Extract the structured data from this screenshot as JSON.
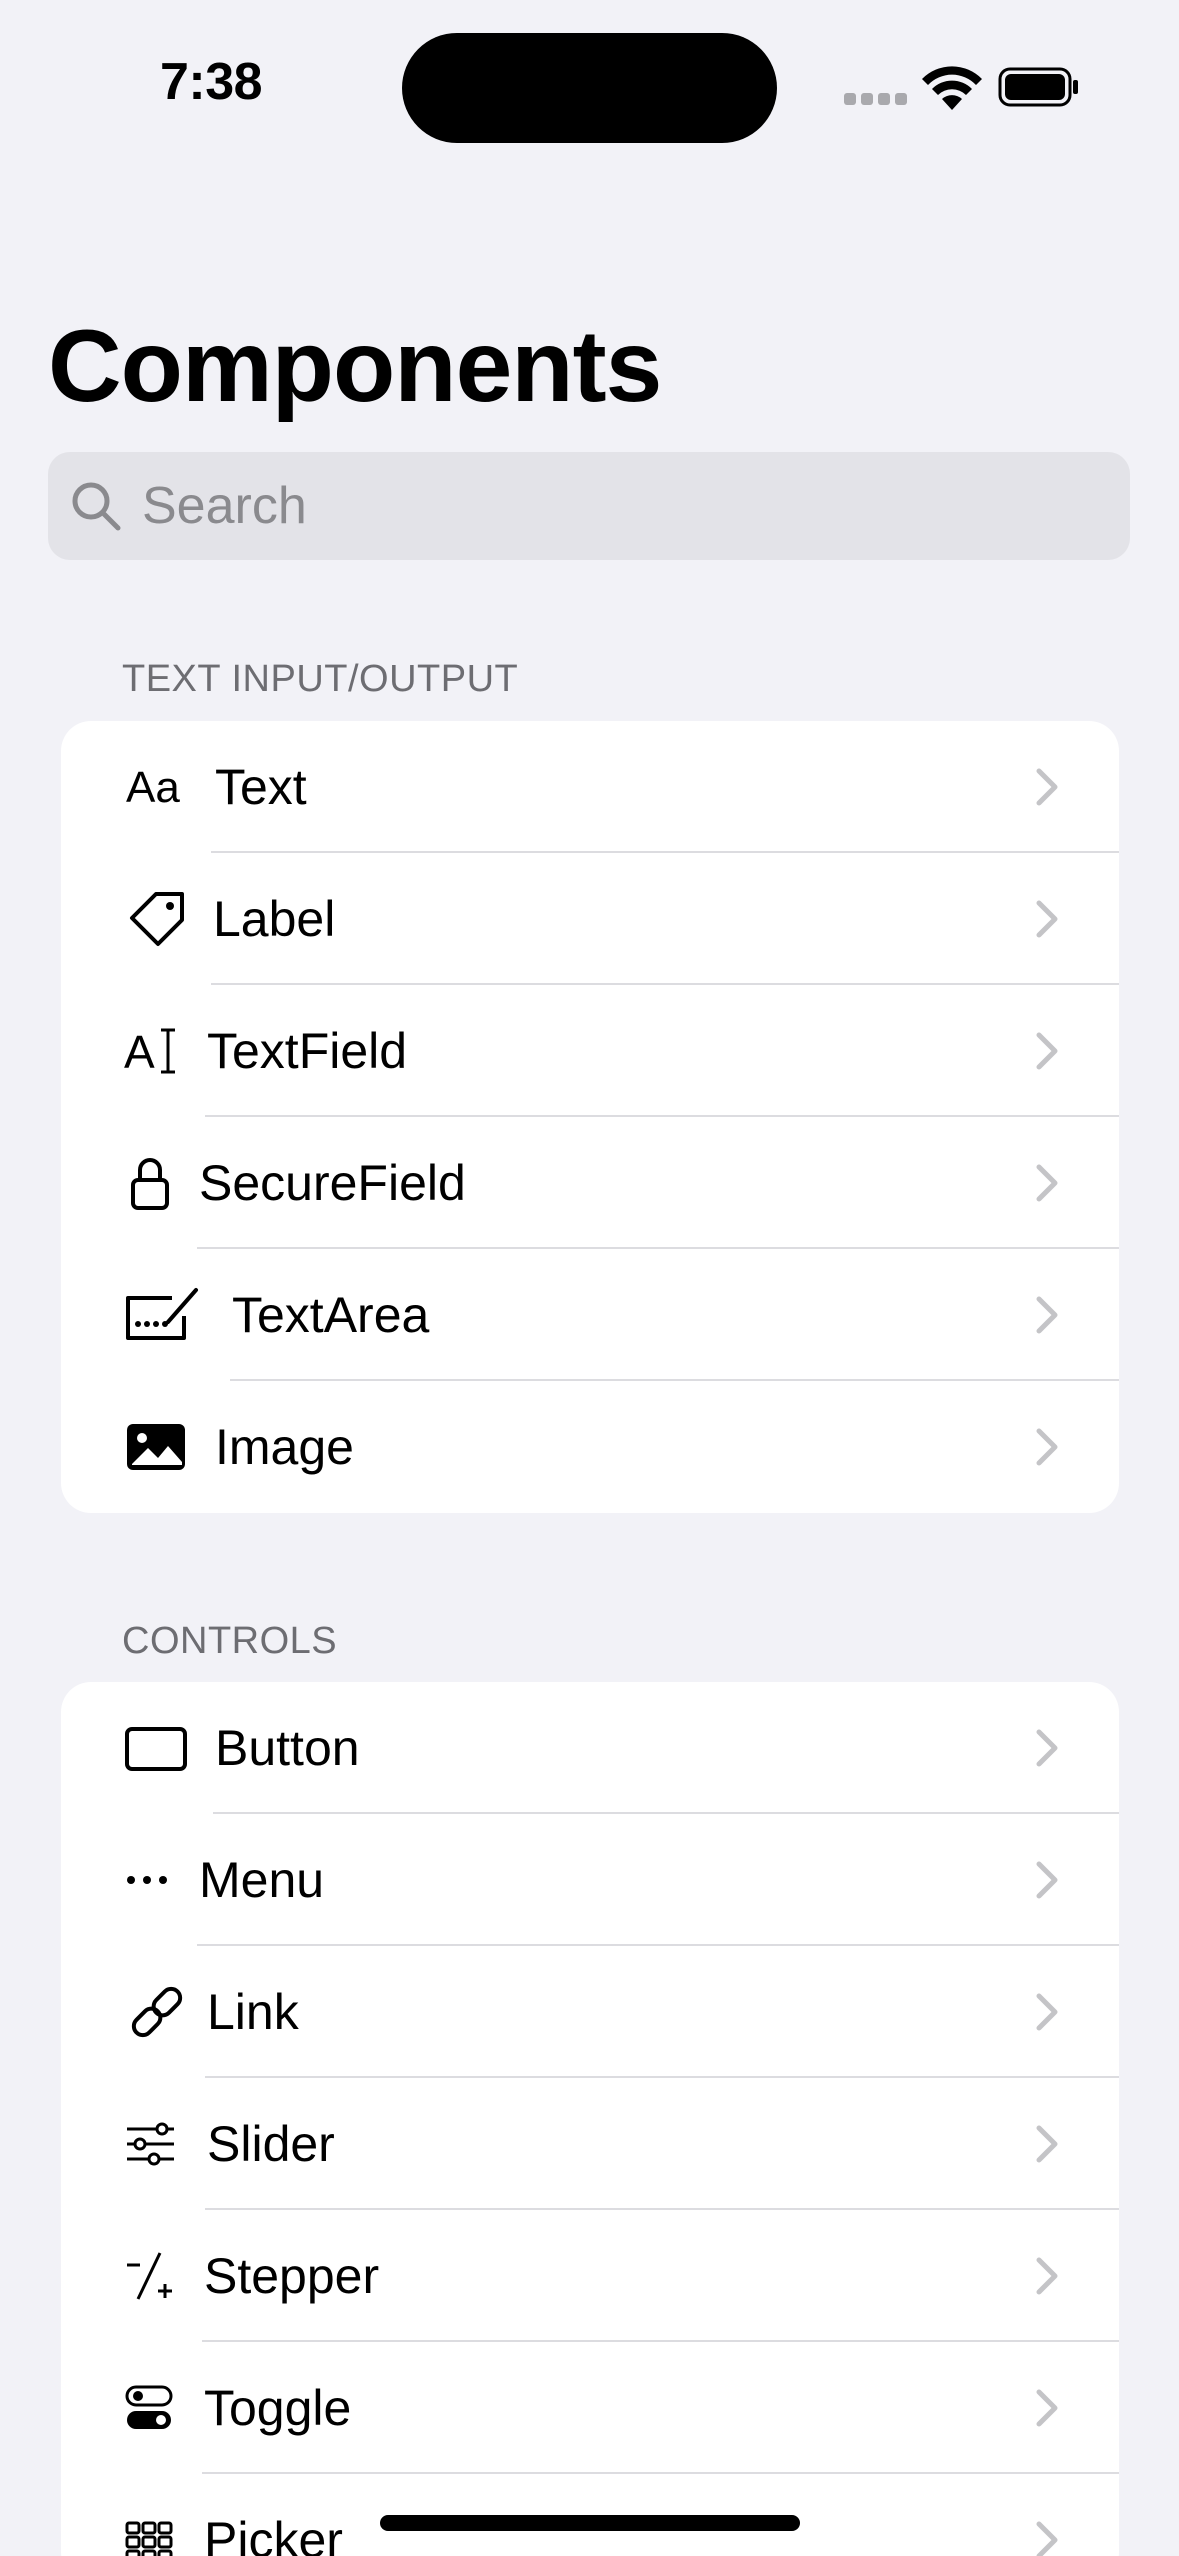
{
  "status_bar": {
    "time": "7:38"
  },
  "title": "Components",
  "search": {
    "placeholder": "Search",
    "value": ""
  },
  "sections": [
    {
      "header": "TEXT INPUT/OUTPUT",
      "items": [
        {
          "label": "Text",
          "icon": "textformat-icon"
        },
        {
          "label": "Label",
          "icon": "tag-icon"
        },
        {
          "label": "TextField",
          "icon": "textfield-icon"
        },
        {
          "label": "SecureField",
          "icon": "lock-icon"
        },
        {
          "label": "TextArea",
          "icon": "signature-icon"
        },
        {
          "label": "Image",
          "icon": "photo-icon"
        }
      ]
    },
    {
      "header": "CONTROLS",
      "items": [
        {
          "label": "Button",
          "icon": "rectangle-icon"
        },
        {
          "label": "Menu",
          "icon": "ellipsis-icon"
        },
        {
          "label": "Link",
          "icon": "link-icon"
        },
        {
          "label": "Slider",
          "icon": "slider-icon"
        },
        {
          "label": "Stepper",
          "icon": "plus-slash-minus-icon"
        },
        {
          "label": "Toggle",
          "icon": "switch-icon"
        },
        {
          "label": "Picker",
          "icon": "grid-icon"
        }
      ]
    }
  ]
}
